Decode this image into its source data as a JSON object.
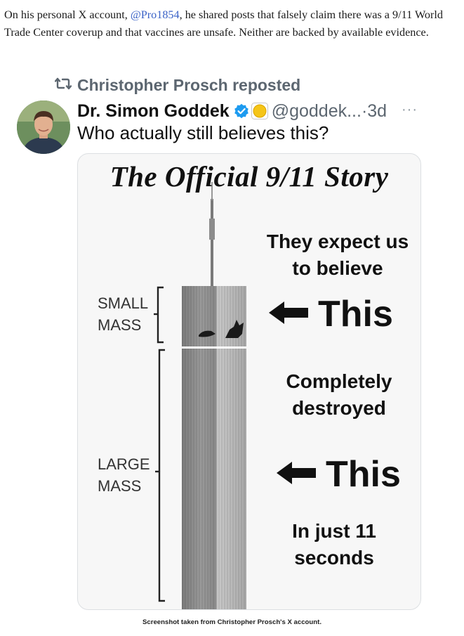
{
  "article": {
    "text_before": "On his personal X account, ",
    "handle": "@Pro1854",
    "text_after": ", he shared posts that falsely claim there was a 9/11 World Trade Center coverup and that vaccines are unsafe. Neither are backed by available evidence."
  },
  "tweet": {
    "repost_label": "Christopher Prosch reposted",
    "display_name": "Dr. Simon Goddek",
    "handle": "@goddek...",
    "separator": "·",
    "time_ago": "3d",
    "text": "Who actually still believes this?",
    "icons": {
      "repost": "repost-icon",
      "verified": "verified-badge-icon",
      "affiliate": "yellow-emoji-badge-icon",
      "more": "more-options-icon"
    },
    "colors": {
      "verified": "#1d9bf0",
      "secondary_text": "#5c6670"
    }
  },
  "meme": {
    "title": "The Official 9/11 Story",
    "label_small": "SMALL\nMASS",
    "label_large": "LARGE\nMASS",
    "caption_expect": "They expect us\nto believe",
    "caption_this_1": "This",
    "caption_destroyed": "Completely\ndestroyed",
    "caption_this_2": "This",
    "caption_seconds": "In just 11\nseconds",
    "arrow_icon": "left-arrow-icon"
  },
  "footer": {
    "caption": "Screenshot taken from Christopher Prosch's X account."
  }
}
